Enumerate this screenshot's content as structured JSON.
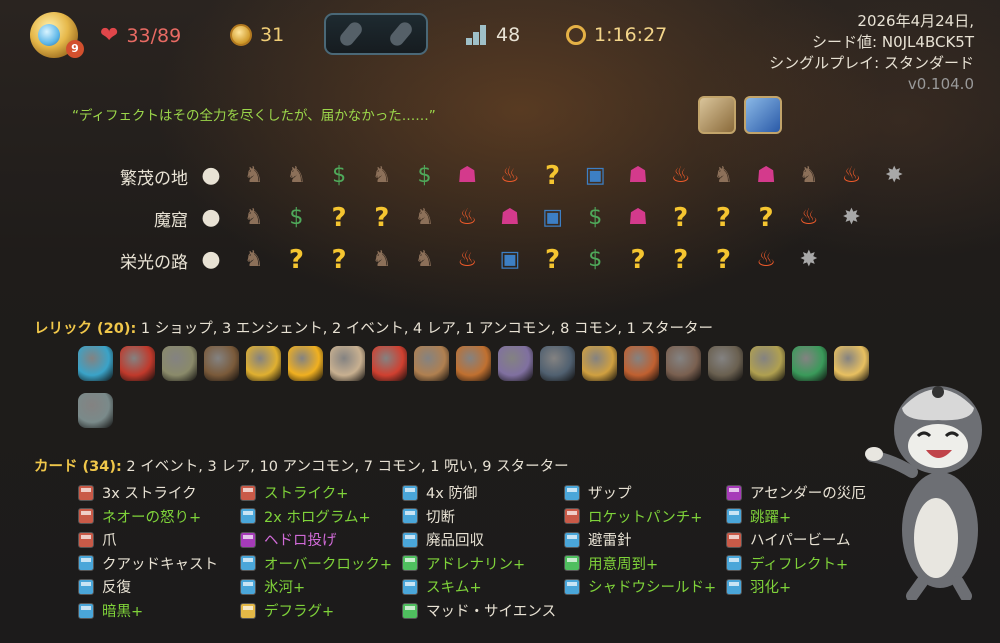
{
  "hud": {
    "potion_count": "9",
    "hp": "33/89",
    "gold": "31",
    "floor": "48",
    "time": "1:16:27"
  },
  "seed_info": {
    "date": "2026年4月24日,",
    "seed": "シード値: N0JL4BCK5T",
    "mode": "シングルプレイ: スタンダード",
    "version": "v0.104.0"
  },
  "quote": "“ディフェクトはその全力を尽くしたが、届かなかった……”",
  "acts": [
    {
      "name": "繁茂の地",
      "nodes": [
        "start",
        "monster",
        "monster",
        "money",
        "monster",
        "money",
        "elite",
        "fire",
        "question",
        "shop",
        "elite",
        "fire",
        "monster",
        "elite",
        "monster",
        "fire",
        "boss"
      ]
    },
    {
      "name": "魔窟",
      "nodes": [
        "start",
        "monster",
        "money",
        "question",
        "question",
        "monster",
        "fire",
        "elite",
        "shop",
        "money",
        "elite",
        "question",
        "elite-q",
        "question",
        "fire",
        "boss"
      ]
    },
    {
      "name": "栄光の路",
      "nodes": [
        "start",
        "monster",
        "question",
        "question",
        "monster",
        "monster",
        "fire",
        "shop",
        "question",
        "money",
        "question",
        "elite-q",
        "question",
        "fire",
        "boss"
      ]
    }
  ],
  "relics": {
    "label": "レリック (20):",
    "summary": "1 ショップ, 3 エンシェント, 2 イベント, 4 レア, 1 アンコモン, 8 コモン, 1 スターター",
    "colors": [
      "#3aa3c8",
      "#c0392b",
      "#8a8a6a",
      "#7a5a3a",
      "#e0b030",
      "#f0b020",
      "#c8b090",
      "#d04030",
      "#b08050",
      "#c07030",
      "#8070a0",
      "#506070",
      "#d0a040",
      "#c06030",
      "#7a6050",
      "#6a6050",
      "#b0a050",
      "#3a9a5a",
      "#e8c060",
      "#7a8a8a"
    ]
  },
  "cards": {
    "label": "カード (34):",
    "summary": "2 イベント, 3 レア, 10 アンコモン, 7 コモン, 1 呪い, 9 スターター",
    "columns": [
      [
        {
          "text": "3x ストライク",
          "type": "attack",
          "up": false
        },
        {
          "text": "ネオーの怒り+",
          "type": "attack",
          "up": true
        },
        {
          "text": "爪",
          "type": "attack",
          "up": false
        },
        {
          "text": "クアッドキャスト",
          "type": "skill",
          "up": false
        },
        {
          "text": "反復",
          "type": "skill",
          "up": false
        },
        {
          "text": "暗黒+",
          "type": "skill",
          "up": true
        }
      ],
      [
        {
          "text": "ストライク+",
          "type": "attack",
          "up": true
        },
        {
          "text": "2x ホログラム+",
          "type": "skill",
          "up": true
        },
        {
          "text": "ヘドロ投げ",
          "type": "curse",
          "up": false
        },
        {
          "text": "オーバークロック+",
          "type": "skill",
          "up": true
        },
        {
          "text": "氷河+",
          "type": "skill",
          "up": true
        },
        {
          "text": "デフラグ+",
          "type": "power",
          "up": true
        }
      ],
      [
        {
          "text": "4x 防御",
          "type": "skill",
          "up": false
        },
        {
          "text": "切断",
          "type": "skill",
          "up": false
        },
        {
          "text": "廃品回収",
          "type": "skill",
          "up": false
        },
        {
          "text": "アドレナリン+",
          "type": "quest",
          "up": true
        },
        {
          "text": "スキム+",
          "type": "skill",
          "up": true
        },
        {
          "text": "マッド・サイエンス",
          "type": "quest",
          "up": false
        }
      ],
      [
        {
          "text": "ザップ",
          "type": "skill",
          "up": false
        },
        {
          "text": "ロケットパンチ+",
          "type": "attack",
          "up": true
        },
        {
          "text": "避雷針",
          "type": "skill",
          "up": false
        },
        {
          "text": "用意周到+",
          "type": "quest",
          "up": true
        },
        {
          "text": "シャドウシールド+",
          "type": "skill",
          "up": true
        }
      ],
      [
        {
          "text": "アセンダーの災厄",
          "type": "curse",
          "up": false
        },
        {
          "text": "跳躍+",
          "type": "skill",
          "up": true
        },
        {
          "text": "ハイパービーム",
          "type": "attack",
          "up": false
        },
        {
          "text": "ディフレクト+",
          "type": "skill",
          "up": true
        },
        {
          "text": "羽化+",
          "type": "skill",
          "up": true
        }
      ]
    ]
  }
}
